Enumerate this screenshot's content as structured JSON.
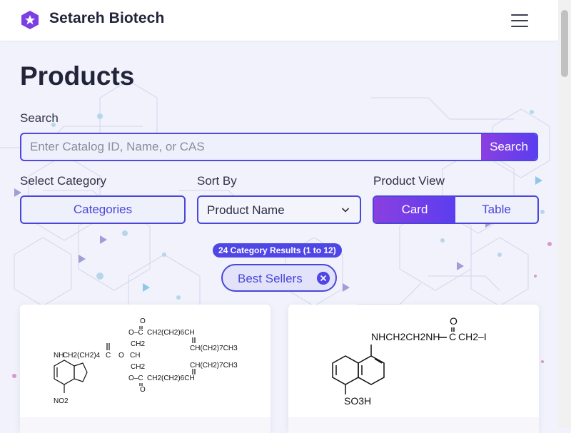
{
  "header": {
    "brand": "Setareh Biotech",
    "logo_icon": "hexagon-star-logo",
    "menu_icon": "hamburger-menu-icon",
    "brand_colors": {
      "primary": "#5b3ef0",
      "accent": "#8b3fe0"
    }
  },
  "main": {
    "title": "Products",
    "search": {
      "label": "Search",
      "placeholder": "Enter Catalog ID, Name, or CAS",
      "value": "",
      "button_label": "Search"
    },
    "category": {
      "label": "Select Category",
      "button_label": "Categories"
    },
    "sort": {
      "label": "Sort By",
      "selected": "Product Name"
    },
    "view": {
      "label": "Product View",
      "options": [
        "Card",
        "Table"
      ],
      "selected": "Card"
    },
    "results_badge": "24 Category Results (1 to 12)",
    "filter_chip": {
      "label": "Best Sellers",
      "remove_icon": "close-circle-icon"
    }
  },
  "products": [
    {
      "structure": {
        "nh": "NH",
        "chain": "CH2(CH2)4",
        "c": "C",
        "o": "O",
        "ch2": "CH2",
        "ch": "CH",
        "oc": "O–C",
        "tail": "CH2(CH2)6CH",
        "ch3": "CH(CH2)7CH3",
        "no2": "NO2"
      }
    },
    {
      "structure": {
        "amine": "NHCH2CH2NH",
        "ch2i": "CH2–I",
        "c": "C",
        "o": "O",
        "so3h": "SO3H"
      }
    }
  ]
}
